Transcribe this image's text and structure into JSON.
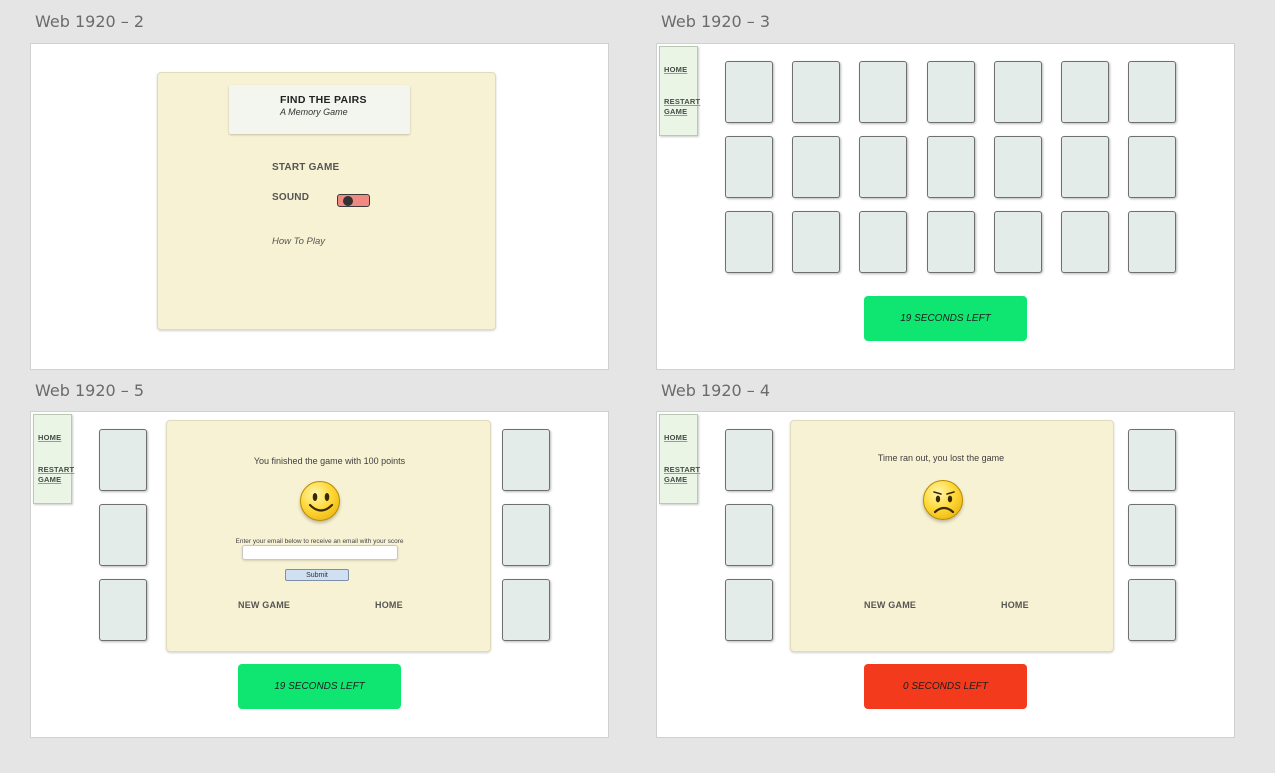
{
  "frames": {
    "f2": {
      "label": "Web 1920 – 2"
    },
    "f3": {
      "label": "Web 1920 – 3"
    },
    "f5": {
      "label": "Web 1920 – 5"
    },
    "f4": {
      "label": "Web 1920 – 4"
    }
  },
  "menu": {
    "title": "FIND THE PAIRS",
    "subtitle": "A Memory Game",
    "start_game": "START GAME",
    "sound": "SOUND",
    "sound_on": false,
    "how_to_play": "How To Play"
  },
  "sidebar": {
    "home": "HOME",
    "restart_line1": "RESTART",
    "restart_line2": "GAME"
  },
  "game": {
    "timer_text": "19 SECONDS LEFT",
    "timer_color": "#0fe672"
  },
  "win": {
    "message": "You finished the game with  100 points",
    "email_prompt": "Enter your email below to receive an email with your score",
    "email_value": "",
    "submit": "Submit",
    "new_game": "NEW GAME",
    "home": "HOME",
    "face": "smiley-face-icon",
    "timer_text": "19 SECONDS LEFT",
    "timer_color": "#0fe672"
  },
  "lose": {
    "message": "Time ran out, you lost the game",
    "new_game": "NEW GAME",
    "home": "HOME",
    "face": "sad-face-icon",
    "timer_text": "0 SECONDS LEFT",
    "timer_color": "#f33a1c"
  }
}
